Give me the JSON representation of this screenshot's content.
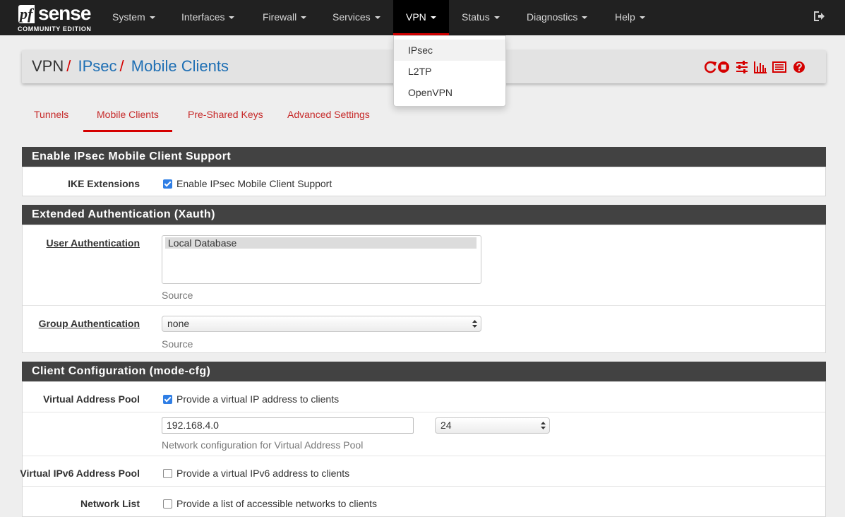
{
  "brand": {
    "name_pf": "pf",
    "name_sense": "sense",
    "edition": "COMMUNITY EDITION"
  },
  "nav": {
    "items": [
      {
        "label": "System"
      },
      {
        "label": "Interfaces"
      },
      {
        "label": "Firewall"
      },
      {
        "label": "Services"
      },
      {
        "label": "VPN"
      },
      {
        "label": "Status"
      },
      {
        "label": "Diagnostics"
      },
      {
        "label": "Help"
      }
    ],
    "active": "VPN",
    "vpn_dropdown": [
      "IPsec",
      "L2TP",
      "OpenVPN"
    ]
  },
  "breadcrumb": {
    "root": "VPN",
    "level1": "IPsec",
    "level2": "Mobile Clients",
    "separator": "/"
  },
  "toolbar_icons": [
    "reload-icon",
    "stop-icon",
    "sliders-icon",
    "bar-chart-icon",
    "log-list-icon",
    "help-icon"
  ],
  "tabs": [
    {
      "label": "Tunnels"
    },
    {
      "label": "Mobile Clients"
    },
    {
      "label": "Pre-Shared Keys"
    },
    {
      "label": "Advanced Settings"
    }
  ],
  "active_tab": "Mobile Clients",
  "sections": {
    "mobile_support": {
      "title": "Enable IPsec Mobile Client Support",
      "ike_label": "IKE Extensions",
      "ike_checkbox_text": "Enable IPsec Mobile Client Support",
      "ike_checked": true
    },
    "xauth": {
      "title": "Extended Authentication (Xauth)",
      "user_auth_label": "User Authentication",
      "user_auth_options": [
        "Local Database"
      ],
      "user_auth_help": "Source",
      "group_auth_label": "Group Authentication",
      "group_auth_value": "none",
      "group_auth_help": "Source"
    },
    "mode_cfg": {
      "title": "Client Configuration (mode-cfg)",
      "vpool_label": "Virtual Address Pool",
      "vpool_checkbox_text": "Provide a virtual IP address to clients",
      "vpool_checked": true,
      "vpool_network": "192.168.4.0",
      "vpool_mask": "24",
      "vpool_help": "Network configuration for Virtual Address Pool",
      "v6pool_label": "Virtual IPv6 Address Pool",
      "v6pool_checkbox_text": "Provide a virtual IPv6 address to clients",
      "v6pool_checked": false,
      "netlist_label": "Network List",
      "netlist_checkbox_text": "Provide a list of accessible networks to clients",
      "netlist_checked": false
    }
  },
  "colors": {
    "accent": "#d50000",
    "link": "#1e6fb4",
    "navbar": "#212121",
    "panel_heading": "#424242"
  }
}
